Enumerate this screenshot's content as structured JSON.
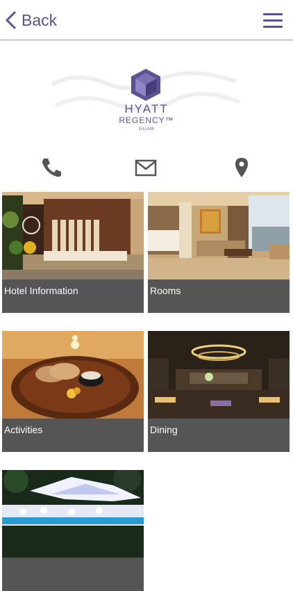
{
  "header": {
    "back_label": "Back",
    "accent_color": "#5b5294"
  },
  "logo": {
    "name": "HYATT",
    "line2": "REGENCY™",
    "location": "GUAM"
  },
  "contact": {
    "icons": [
      "phone-icon",
      "mail-icon",
      "location-pin-icon"
    ]
  },
  "tiles": [
    {
      "label": "Hotel Information"
    },
    {
      "label": "Rooms"
    },
    {
      "label": "Activities"
    },
    {
      "label": "Dining"
    },
    {
      "label": ""
    }
  ]
}
